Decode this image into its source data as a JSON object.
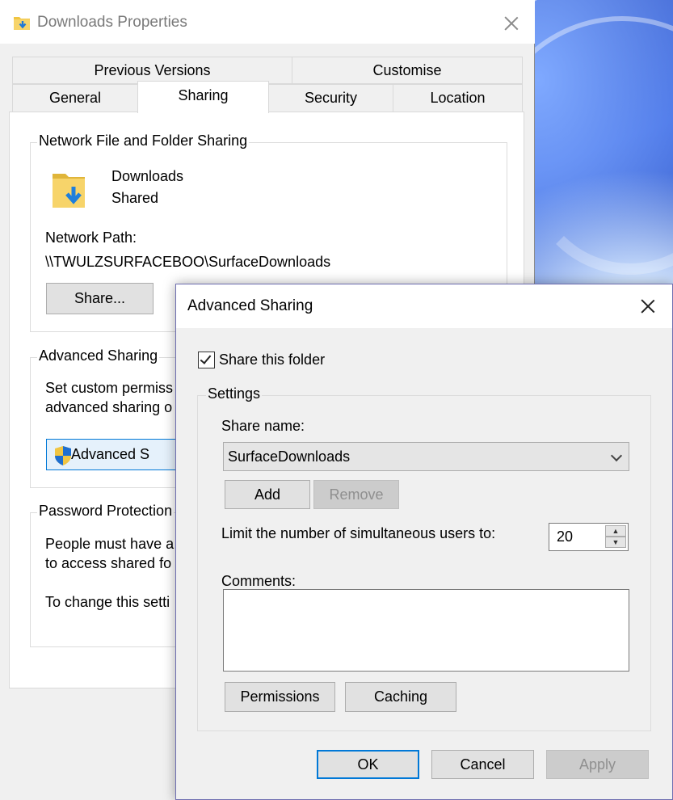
{
  "colors": {
    "accent": "#0078d7",
    "folder_yellow": "#f0c542",
    "arrow_blue": "#1e90ff",
    "window_bg": "#f0f0f0"
  },
  "main_window": {
    "title": "Downloads Properties",
    "icon": "folder-download-icon",
    "tabs_top": [
      "Previous Versions",
      "Customise"
    ],
    "tabs_bottom": [
      "General",
      "Sharing",
      "Security",
      "Location"
    ],
    "active_tab": "Sharing",
    "network_sharing": {
      "legend": "Network File and Folder Sharing",
      "folder_name": "Downloads",
      "status": "Shared",
      "path_label": "Network Path:",
      "path": "\\\\TWULZSURFACEBOO\\SurfaceDownloads",
      "share_button": "Share..."
    },
    "advanced_sharing": {
      "legend": "Advanced Sharing",
      "desc_line1": "Set custom permiss",
      "desc_line2": "advanced sharing o",
      "button": "Advanced S",
      "button_icon": "uac-shield-icon"
    },
    "password_protection": {
      "legend": "Password Protection",
      "line1": "People must have a",
      "line2": "to access shared fo",
      "line3": "To change this setti"
    }
  },
  "dialog": {
    "title": "Advanced Sharing",
    "share_checkbox": {
      "label": "Share this folder",
      "checked": true
    },
    "settings": {
      "legend": "Settings",
      "share_name_label": "Share name:",
      "share_name": "SurfaceDownloads",
      "add": "Add",
      "remove": "Remove",
      "limit_label": "Limit the number of simultaneous users to:",
      "limit_value": "20",
      "comments_label": "Comments:",
      "comments_value": "",
      "permissions": "Permissions",
      "caching": "Caching"
    },
    "buttons": {
      "ok": "OK",
      "cancel": "Cancel",
      "apply": "Apply"
    }
  }
}
